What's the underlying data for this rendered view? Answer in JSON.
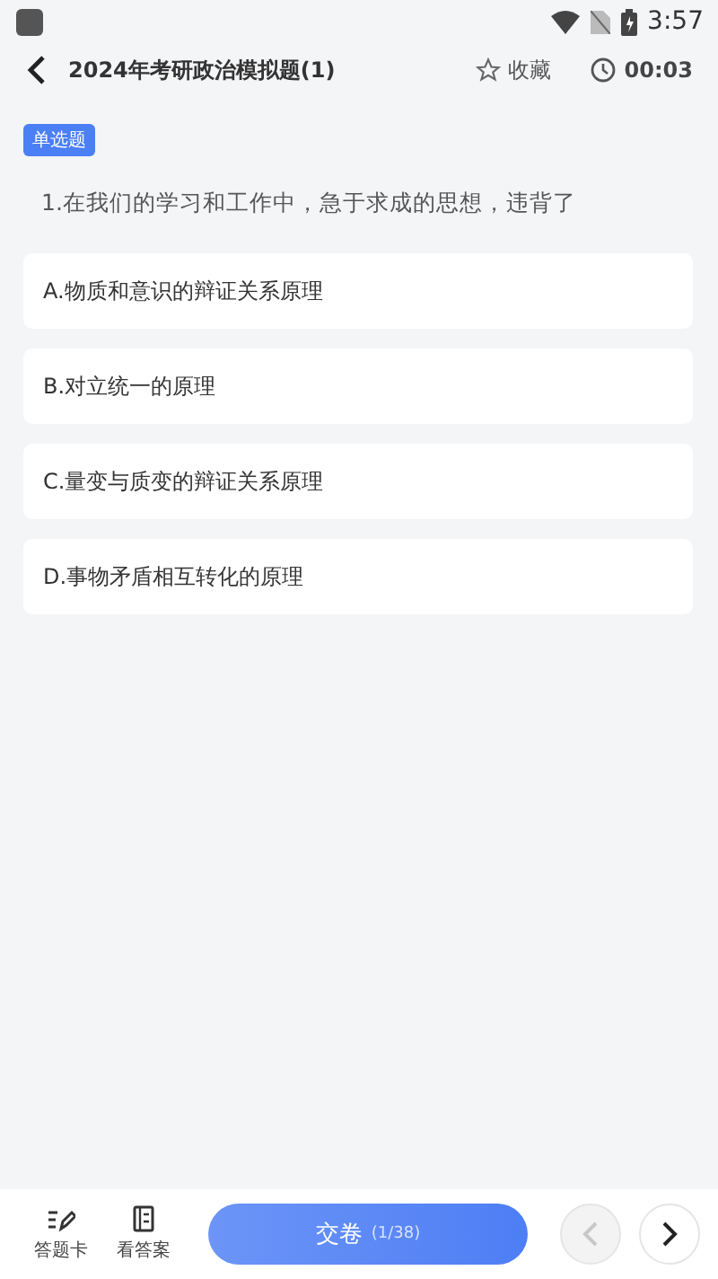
{
  "status_bar": {
    "time": "3:57"
  },
  "header": {
    "title": "2024年考研政治模拟题(1)",
    "favorite": {
      "label": "收藏"
    },
    "timer": "00:03"
  },
  "question": {
    "type_tag": "单选题",
    "text": "1.在我们的学习和工作中，急于求成的思想，违背了"
  },
  "options": [
    {
      "text": "A.物质和意识的辩证关系原理",
      "selected": false
    },
    {
      "text": "B.对立统一的原理",
      "selected": false
    },
    {
      "text": "C.量变与质变的辩证关系原理",
      "selected": false
    },
    {
      "text": "D.事物矛盾相互转化的原理",
      "selected": false
    }
  ],
  "bottom_bar": {
    "answer_card": "答题卡",
    "view_answer": "看答案",
    "submit": {
      "label": "交卷",
      "progress": "(1/38)"
    },
    "prev_disabled": true,
    "next_disabled": false
  }
}
